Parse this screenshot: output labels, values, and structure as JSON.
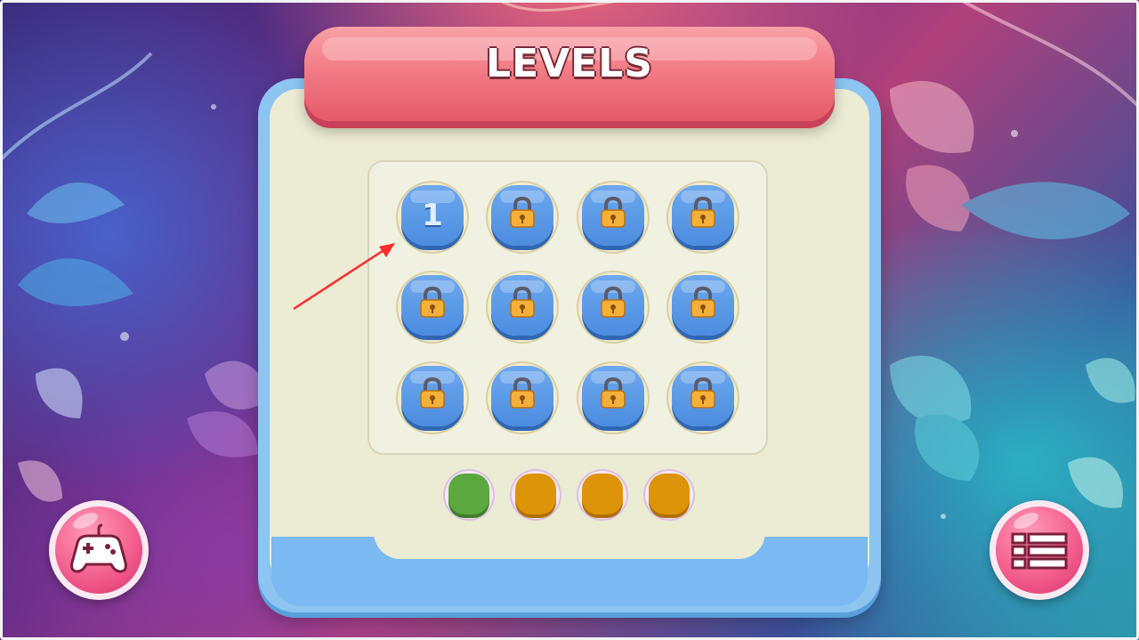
{
  "header": {
    "title": "LEVELS"
  },
  "levels": [
    {
      "label": "1",
      "state": "unlocked"
    },
    {
      "label": "",
      "state": "locked"
    },
    {
      "label": "",
      "state": "locked"
    },
    {
      "label": "",
      "state": "locked"
    },
    {
      "label": "",
      "state": "locked"
    },
    {
      "label": "",
      "state": "locked"
    },
    {
      "label": "",
      "state": "locked"
    },
    {
      "label": "",
      "state": "locked"
    },
    {
      "label": "",
      "state": "locked"
    },
    {
      "label": "",
      "state": "locked"
    },
    {
      "label": "",
      "state": "locked"
    },
    {
      "label": "",
      "state": "locked"
    }
  ],
  "pager": {
    "pages": 4,
    "current": 1,
    "active_color": "#5aa83e",
    "inactive_color": "#de9408"
  },
  "buttons": {
    "left_icon": "gamepad-icon",
    "right_icon": "list-menu-icon"
  },
  "colors": {
    "banner": "#f27c86",
    "panel": "#8cc4f2",
    "level_button": "#4c8ce0",
    "lock": "#f5b03a"
  }
}
